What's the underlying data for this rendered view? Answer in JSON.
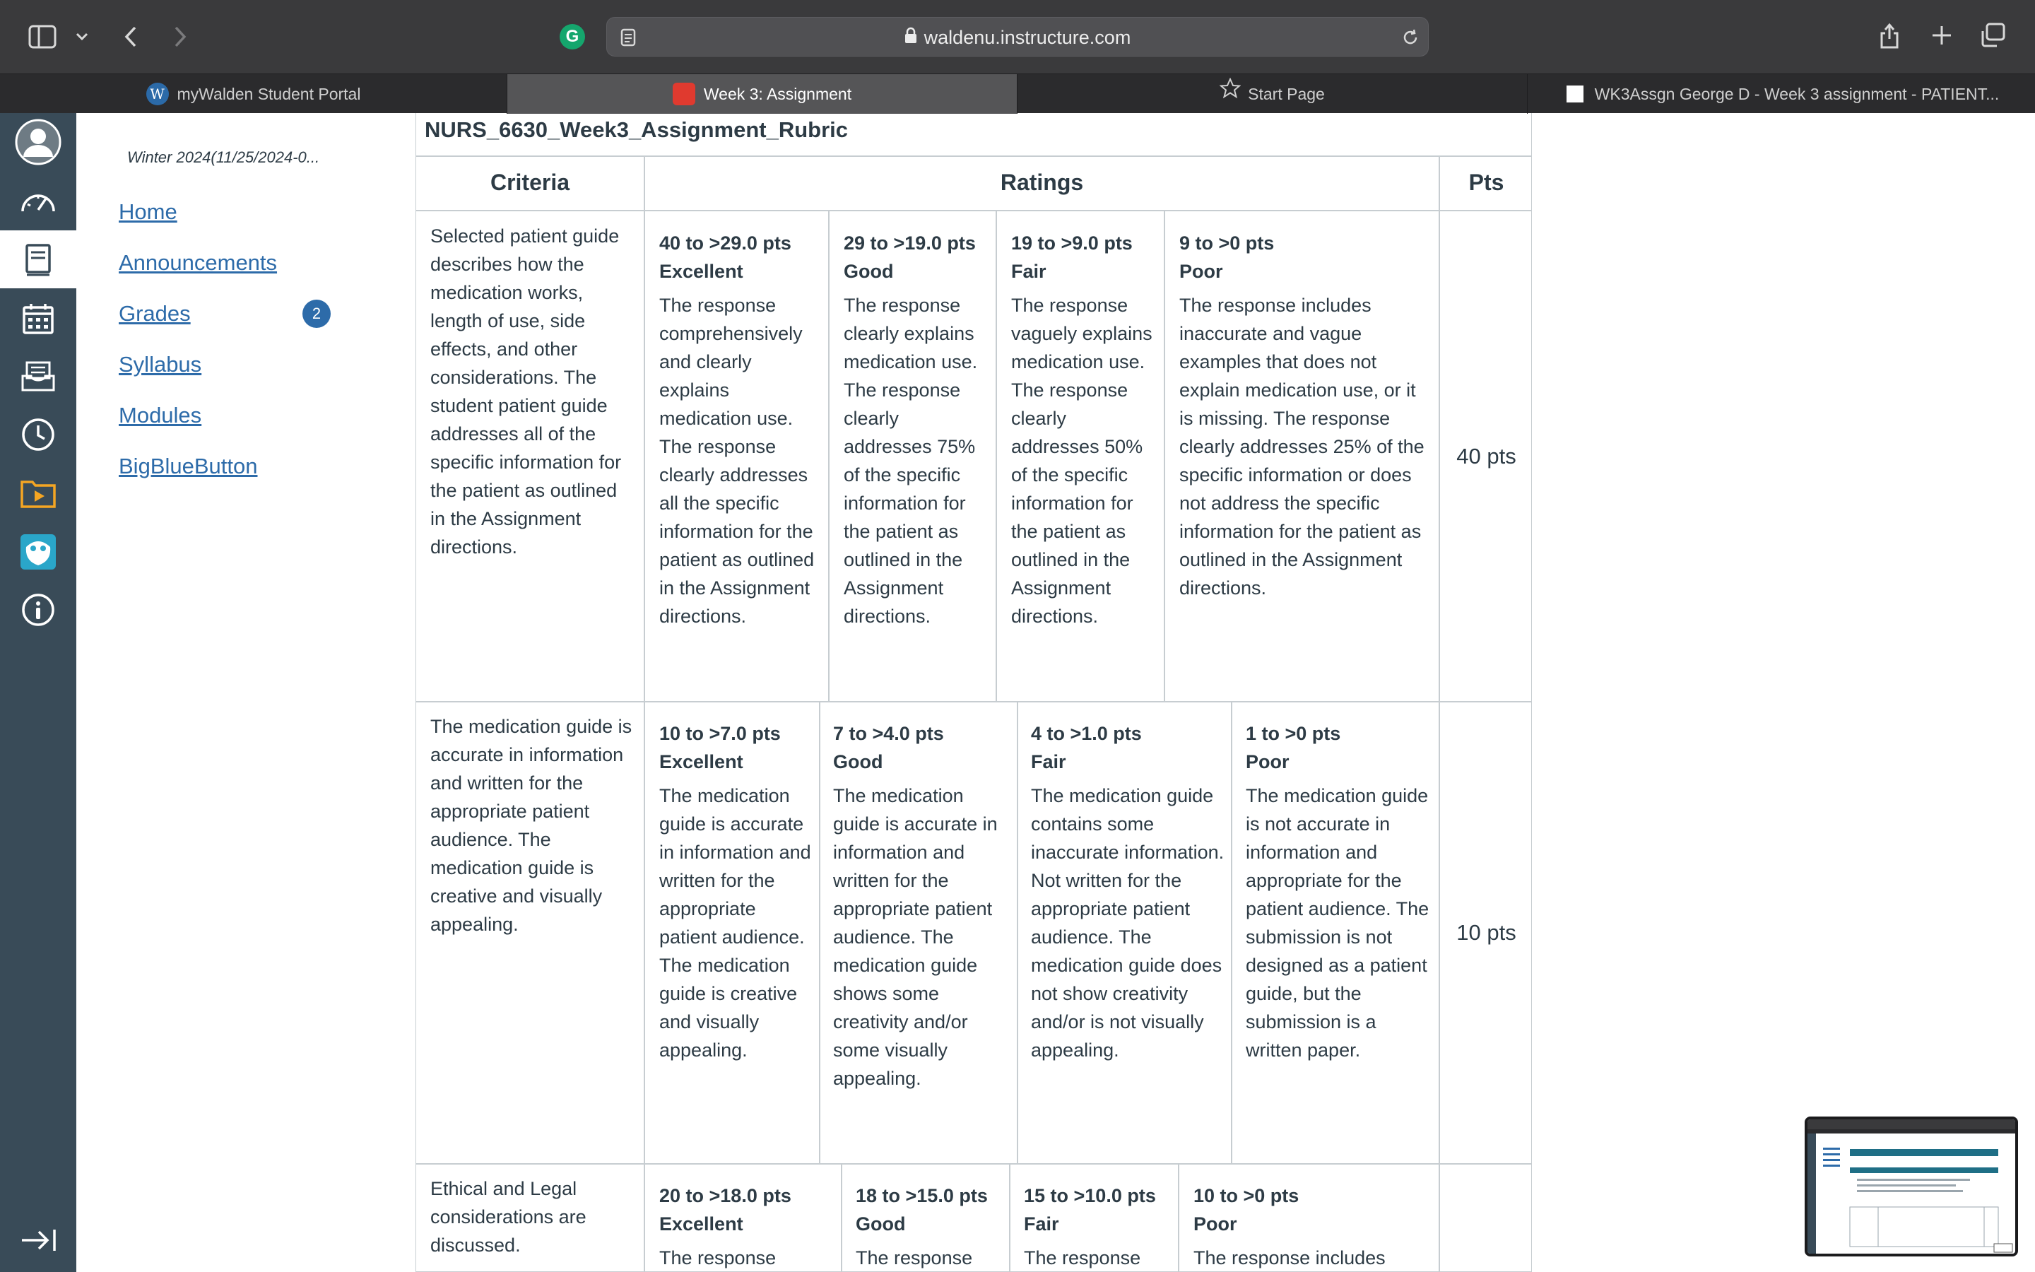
{
  "browser": {
    "url": "waldenu.instructure.com",
    "tabs": [
      {
        "label": "myWalden Student Portal",
        "active": false
      },
      {
        "label": "Week 3: Assignment",
        "active": true
      },
      {
        "label": "Start Page",
        "active": false
      },
      {
        "label": "WK3Assgn George D - Week 3 assignment - PATIENT...",
        "active": false
      }
    ]
  },
  "course_nav": {
    "term": "Winter 2024(11/25/2024-0...",
    "items": [
      {
        "label": "Home"
      },
      {
        "label": "Announcements"
      },
      {
        "label": "Grades",
        "badge": "2"
      },
      {
        "label": "Syllabus"
      },
      {
        "label": "Modules"
      },
      {
        "label": "BigBlueButton"
      }
    ]
  },
  "rubric": {
    "title": "NURS_6630_Week3_Assignment_Rubric",
    "headers": {
      "criteria": "Criteria",
      "ratings": "Ratings",
      "pts": "Pts"
    },
    "rows": [
      {
        "criterion": "Selected patient guide describes how the medication works, length of use, side effects, and other considerations. The student patient guide addresses all of the specific information for the patient as outlined in the Assignment directions.",
        "pts": "40 pts",
        "ratings": [
          {
            "pts": "40 to >29.0 pts",
            "level": "Excellent",
            "desc": "The response comprehensively and clearly explains medication use. The response clearly addresses all the specific information for the patient as outlined in the Assignment directions."
          },
          {
            "pts": "29 to >19.0 pts",
            "level": "Good",
            "desc": "The response clearly explains medication use. The response clearly addresses 75% of the specific information for the patient as outlined in the Assignment directions."
          },
          {
            "pts": "19 to >9.0 pts",
            "level": "Fair",
            "desc": "The response vaguely explains medication use. The response clearly addresses 50% of the specific information for the patient as outlined in the Assignment directions."
          },
          {
            "pts": "9 to >0 pts",
            "level": "Poor",
            "desc": "The response includes inaccurate and vague examples that does not explain medication use, or it is missing. The response clearly addresses 25% of the specific information or does not address the specific information for the patient as outlined in the Assignment directions."
          }
        ]
      },
      {
        "criterion": "The medication guide is accurate in information and written for the appropriate patient audience. The medication guide is creative and visually appealing.",
        "pts": "10 pts",
        "ratings": [
          {
            "pts": "10 to >7.0 pts",
            "level": "Excellent",
            "desc": "The medication guide is accurate in information and written for the appropriate patient audience. The medication guide is creative and visually appealing."
          },
          {
            "pts": "7 to >4.0 pts",
            "level": "Good",
            "desc": "The medication guide is accurate in information and written for the appropriate patient audience. The medication guide shows some creativity and/or some visually appealing."
          },
          {
            "pts": "4 to >1.0 pts",
            "level": "Fair",
            "desc": "The medication guide contains some inaccurate information. Not written for the appropriate patient audience. The medication guide does not show creativity and/or is not visually appealing."
          },
          {
            "pts": "1 to >0 pts",
            "level": "Poor",
            "desc": "The medication guide is not accurate in information and appropriate for the patient audience. The submission is not designed as a patient guide, but the submission is a written paper."
          }
        ]
      },
      {
        "criterion": "Ethical and Legal considerations are discussed.",
        "pts": "",
        "ratings": [
          {
            "pts": "20 to >18.0 pts",
            "level": "Excellent",
            "desc": "The response"
          },
          {
            "pts": "18 to >15.0 pts",
            "level": "Good",
            "desc": "The response"
          },
          {
            "pts": "15 to >10.0 pts",
            "level": "Fair",
            "desc": "The response"
          },
          {
            "pts": "10 to >0 pts",
            "level": "Poor",
            "desc": "The response includes"
          }
        ]
      }
    ]
  },
  "colors": {
    "global_nav": "#394b58",
    "link": "#2d6ba9",
    "chrome_toolbar": "#3a3a3c",
    "table_border": "#c7cdd1"
  }
}
